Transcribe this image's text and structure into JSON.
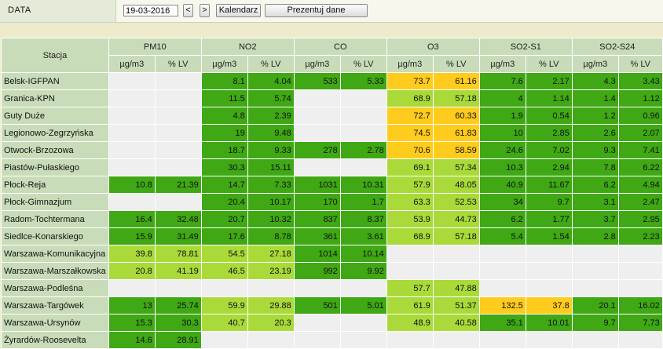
{
  "header": {
    "data_label": "DATA",
    "date_value": "19-03-2016",
    "prev_label": "<",
    "next_label": ">",
    "calendar_label": "Kalendarz",
    "show_label": "Prezentuj dane"
  },
  "table": {
    "station_header": "Stacja",
    "groups": [
      "PM10",
      "NO2",
      "CO",
      "O3",
      "SO2-S1",
      "SO2-S24"
    ],
    "sub_headers": [
      "µg/m3",
      "% LV"
    ],
    "rows": [
      {
        "station": "Belsk-IGFPAN",
        "cells": [
          [
            "",
            ""
          ],
          [
            "8.1",
            "4.04"
          ],
          [
            "533",
            "5.33"
          ],
          [
            "73.7",
            "61.16"
          ],
          [
            "7.6",
            "2.17"
          ],
          [
            "4.3",
            "3.43"
          ]
        ],
        "levels": [
          "e",
          "dg",
          "dg",
          "y",
          "dg",
          "dg"
        ]
      },
      {
        "station": "Granica-KPN",
        "cells": [
          [
            "",
            ""
          ],
          [
            "11.5",
            "5.74"
          ],
          [
            "",
            ""
          ],
          [
            "68.9",
            "57.18"
          ],
          [
            "4",
            "1.14"
          ],
          [
            "1.4",
            "1.12"
          ]
        ],
        "levels": [
          "e",
          "dg",
          "e",
          "lg",
          "dg",
          "dg"
        ]
      },
      {
        "station": "Guty Duże",
        "cells": [
          [
            "",
            ""
          ],
          [
            "4.8",
            "2.39"
          ],
          [
            "",
            ""
          ],
          [
            "72.7",
            "60.33"
          ],
          [
            "1.9",
            "0.54"
          ],
          [
            "1.2",
            "0.96"
          ]
        ],
        "levels": [
          "e",
          "dg",
          "e",
          "y",
          "dg",
          "dg"
        ]
      },
      {
        "station": "Legionowo-Zegrzyńska",
        "cells": [
          [
            "",
            ""
          ],
          [
            "19",
            "9.48"
          ],
          [
            "",
            ""
          ],
          [
            "74.5",
            "61.83"
          ],
          [
            "10",
            "2.85"
          ],
          [
            "2.6",
            "2.07"
          ]
        ],
        "levels": [
          "e",
          "dg",
          "e",
          "y",
          "dg",
          "dg"
        ]
      },
      {
        "station": "Otwock-Brzozowa",
        "cells": [
          [
            "",
            ""
          ],
          [
            "18.7",
            "9.33"
          ],
          [
            "278",
            "2.78"
          ],
          [
            "70.6",
            "58.59"
          ],
          [
            "24.6",
            "7.02"
          ],
          [
            "9.3",
            "7.41"
          ]
        ],
        "levels": [
          "e",
          "dg",
          "dg",
          "y",
          "dg",
          "dg"
        ]
      },
      {
        "station": "Piastów-Pułaskiego",
        "cells": [
          [
            "",
            ""
          ],
          [
            "30.3",
            "15.11"
          ],
          [
            "",
            ""
          ],
          [
            "69.1",
            "57.34"
          ],
          [
            "10.3",
            "2.94"
          ],
          [
            "7.8",
            "6.22"
          ]
        ],
        "levels": [
          "e",
          "dg",
          "e",
          "lg",
          "dg",
          "dg"
        ]
      },
      {
        "station": "Płock-Reja",
        "cells": [
          [
            "10.8",
            "21.39"
          ],
          [
            "14.7",
            "7.33"
          ],
          [
            "1031",
            "10.31"
          ],
          [
            "57.9",
            "48.05"
          ],
          [
            "40.9",
            "11.67"
          ],
          [
            "6.2",
            "4.94"
          ]
        ],
        "levels": [
          "dg",
          "dg",
          "dg",
          "lg",
          "dg",
          "dg"
        ]
      },
      {
        "station": "Płock-Gimnazjum",
        "cells": [
          [
            "",
            ""
          ],
          [
            "20.4",
            "10.17"
          ],
          [
            "170",
            "1.7"
          ],
          [
            "63.3",
            "52.53"
          ],
          [
            "34",
            "9.7"
          ],
          [
            "3.1",
            "2.47"
          ]
        ],
        "levels": [
          "e",
          "dg",
          "dg",
          "lg",
          "dg",
          "dg"
        ]
      },
      {
        "station": "Radom-Tochtermana",
        "cells": [
          [
            "16.4",
            "32.48"
          ],
          [
            "20.7",
            "10.32"
          ],
          [
            "837",
            "8.37"
          ],
          [
            "53.9",
            "44.73"
          ],
          [
            "6.2",
            "1.77"
          ],
          [
            "3.7",
            "2.95"
          ]
        ],
        "levels": [
          "dg",
          "dg",
          "dg",
          "lg",
          "dg",
          "dg"
        ]
      },
      {
        "station": "Siedlce-Konarskiego",
        "cells": [
          [
            "15.9",
            "31.49"
          ],
          [
            "17.6",
            "8.78"
          ],
          [
            "361",
            "3.61"
          ],
          [
            "68.9",
            "57.18"
          ],
          [
            "5.4",
            "1.54"
          ],
          [
            "2.8",
            "2.23"
          ]
        ],
        "levels": [
          "dg",
          "dg",
          "dg",
          "lg",
          "dg",
          "dg"
        ]
      },
      {
        "station": "Warszawa-Komunikacyjna",
        "cells": [
          [
            "39.8",
            "78.81"
          ],
          [
            "54.5",
            "27.18"
          ],
          [
            "1014",
            "10.14"
          ],
          [
            "",
            ""
          ],
          [
            "",
            ""
          ],
          [
            "",
            ""
          ]
        ],
        "levels": [
          "lg",
          "lg",
          "dg",
          "e",
          "e",
          "e"
        ]
      },
      {
        "station": "Warszawa-Marszałkowska",
        "cells": [
          [
            "20.8",
            "41.19"
          ],
          [
            "46.5",
            "23.19"
          ],
          [
            "992",
            "9.92"
          ],
          [
            "",
            ""
          ],
          [
            "",
            ""
          ],
          [
            "",
            ""
          ]
        ],
        "levels": [
          "lg",
          "lg",
          "dg",
          "e",
          "e",
          "e"
        ]
      },
      {
        "station": "Warszawa-Podleśna",
        "cells": [
          [
            "",
            ""
          ],
          [
            "",
            ""
          ],
          [
            "",
            ""
          ],
          [
            "57.7",
            "47.88"
          ],
          [
            "",
            ""
          ],
          [
            "",
            ""
          ]
        ],
        "levels": [
          "e",
          "e",
          "e",
          "lg",
          "e",
          "e"
        ]
      },
      {
        "station": "Warszawa-Targówek",
        "cells": [
          [
            "13",
            "25.74"
          ],
          [
            "59.9",
            "29.88"
          ],
          [
            "501",
            "5.01"
          ],
          [
            "61.9",
            "51.37"
          ],
          [
            "132.5",
            "37.8"
          ],
          [
            "20.1",
            "16.02"
          ]
        ],
        "levels": [
          "dg",
          "lg",
          "dg",
          "lg",
          "y",
          "dg"
        ]
      },
      {
        "station": "Warszawa-Ursynów",
        "cells": [
          [
            "15.3",
            "30.3"
          ],
          [
            "40.7",
            "20.3"
          ],
          [
            "",
            ""
          ],
          [
            "48.9",
            "40.58"
          ],
          [
            "35.1",
            "10.01"
          ],
          [
            "9.7",
            "7.73"
          ]
        ],
        "levels": [
          "dg",
          "lg",
          "e",
          "lg",
          "dg",
          "dg"
        ]
      },
      {
        "station": "Żyrardów-Roosevelta",
        "cells": [
          [
            "14.6",
            "28.91"
          ],
          [
            "",
            ""
          ],
          [
            "",
            ""
          ],
          [
            "",
            ""
          ],
          [
            "",
            ""
          ],
          [
            "",
            ""
          ]
        ],
        "levels": [
          "dg",
          "e",
          "e",
          "e",
          "e",
          "e"
        ]
      }
    ]
  }
}
